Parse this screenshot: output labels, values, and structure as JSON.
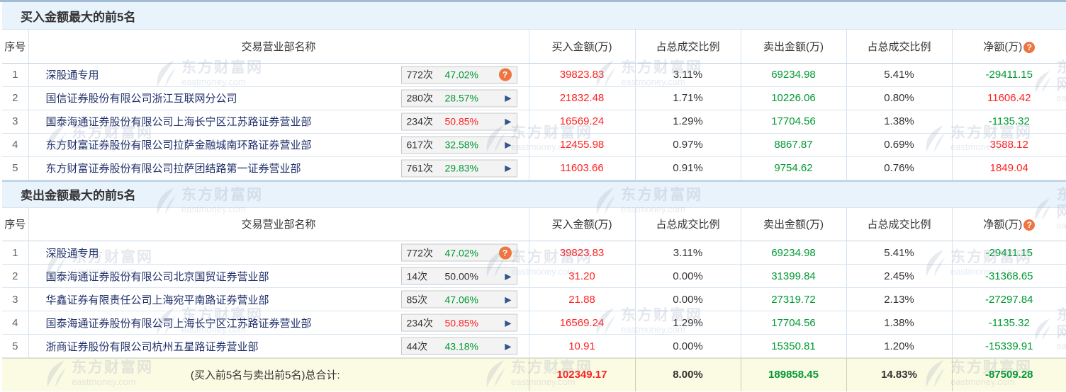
{
  "icons": {
    "help": "?",
    "arrow": "▶"
  },
  "watermark": {
    "cn": "东方财富网",
    "en": "eastmoney.com"
  },
  "colors": {
    "up_red": "#ff2222",
    "down_green": "#009933",
    "help_orange": "#ee7540",
    "band_blue": "#e9f3fc",
    "totals_yellow": "#fbfae3"
  },
  "sections": [
    {
      "title": "买入金额最大的前5名",
      "columns": [
        "序号",
        "交易营业部名称",
        "买入金额(万)",
        "占总成交比例",
        "卖出金额(万)",
        "占总成交比例",
        "净额(万)"
      ],
      "rows": [
        {
          "no": "1",
          "name": "深股通专用",
          "badge_count": "772次",
          "badge_pct": "47.02%",
          "badge_pct_class": "green",
          "icon": "help",
          "buy": "39823.83",
          "buy_pct": "3.11%",
          "sell": "69234.98",
          "sell_pct": "5.41%",
          "net": "-29411.15",
          "net_class": "green"
        },
        {
          "no": "2",
          "name": "国信证券股份有限公司浙江互联网分公司",
          "badge_count": "280次",
          "badge_pct": "28.57%",
          "badge_pct_class": "green",
          "icon": "arrow",
          "buy": "21832.48",
          "buy_pct": "1.71%",
          "sell": "10226.06",
          "sell_pct": "0.80%",
          "net": "11606.42",
          "net_class": "red"
        },
        {
          "no": "3",
          "name": "国泰海通证券股份有限公司上海长宁区江苏路证券营业部",
          "badge_count": "234次",
          "badge_pct": "50.85%",
          "badge_pct_class": "red",
          "icon": "arrow",
          "buy": "16569.24",
          "buy_pct": "1.29%",
          "sell": "17704.56",
          "sell_pct": "1.38%",
          "net": "-1135.32",
          "net_class": "green"
        },
        {
          "no": "4",
          "name": "东方财富证券股份有限公司拉萨金融城南环路证券营业部",
          "badge_count": "617次",
          "badge_pct": "32.58%",
          "badge_pct_class": "green",
          "icon": "arrow",
          "buy": "12455.98",
          "buy_pct": "0.97%",
          "sell": "8867.87",
          "sell_pct": "0.69%",
          "net": "3588.12",
          "net_class": "red"
        },
        {
          "no": "5",
          "name": "东方财富证券股份有限公司拉萨团结路第一证券营业部",
          "badge_count": "761次",
          "badge_pct": "29.83%",
          "badge_pct_class": "green",
          "icon": "arrow",
          "buy": "11603.66",
          "buy_pct": "0.91%",
          "sell": "9754.62",
          "sell_pct": "0.76%",
          "net": "1849.04",
          "net_class": "red"
        }
      ]
    },
    {
      "title": "卖出金额最大的前5名",
      "columns": [
        "序号",
        "交易营业部名称",
        "买入金额(万)",
        "占总成交比例",
        "卖出金额(万)",
        "占总成交比例",
        "净额(万)"
      ],
      "rows": [
        {
          "no": "1",
          "name": "深股通专用",
          "badge_count": "772次",
          "badge_pct": "47.02%",
          "badge_pct_class": "green",
          "icon": "help",
          "buy": "39823.83",
          "buy_pct": "3.11%",
          "sell": "69234.98",
          "sell_pct": "5.41%",
          "net": "-29411.15",
          "net_class": "green"
        },
        {
          "no": "2",
          "name": "国泰海通证券股份有限公司北京国贸证券营业部",
          "badge_count": "14次",
          "badge_pct": "50.00%",
          "badge_pct_class": "black",
          "icon": "arrow",
          "buy": "31.20",
          "buy_pct": "0.00%",
          "sell": "31399.84",
          "sell_pct": "2.45%",
          "net": "-31368.65",
          "net_class": "green"
        },
        {
          "no": "3",
          "name": "华鑫证券有限责任公司上海宛平南路证券营业部",
          "badge_count": "85次",
          "badge_pct": "47.06%",
          "badge_pct_class": "green",
          "icon": "arrow",
          "buy": "21.88",
          "buy_pct": "0.00%",
          "sell": "27319.72",
          "sell_pct": "2.13%",
          "net": "-27297.84",
          "net_class": "green"
        },
        {
          "no": "4",
          "name": "国泰海通证券股份有限公司上海长宁区江苏路证券营业部",
          "badge_count": "234次",
          "badge_pct": "50.85%",
          "badge_pct_class": "red",
          "icon": "arrow",
          "buy": "16569.24",
          "buy_pct": "1.29%",
          "sell": "17704.56",
          "sell_pct": "1.38%",
          "net": "-1135.32",
          "net_class": "green"
        },
        {
          "no": "5",
          "name": "浙商证券股份有限公司杭州五星路证券营业部",
          "badge_count": "44次",
          "badge_pct": "43.18%",
          "badge_pct_class": "green",
          "icon": "arrow",
          "buy": "10.91",
          "buy_pct": "0.00%",
          "sell": "15350.81",
          "sell_pct": "1.20%",
          "net": "-15339.91",
          "net_class": "green"
        }
      ]
    }
  ],
  "footer": {
    "label": "(买入前5名与卖出前5名)总合计:",
    "buy": "102349.17",
    "buy_pct": "8.00%",
    "sell": "189858.45",
    "sell_pct": "14.83%",
    "net": "-87509.28",
    "net_class": "green"
  }
}
